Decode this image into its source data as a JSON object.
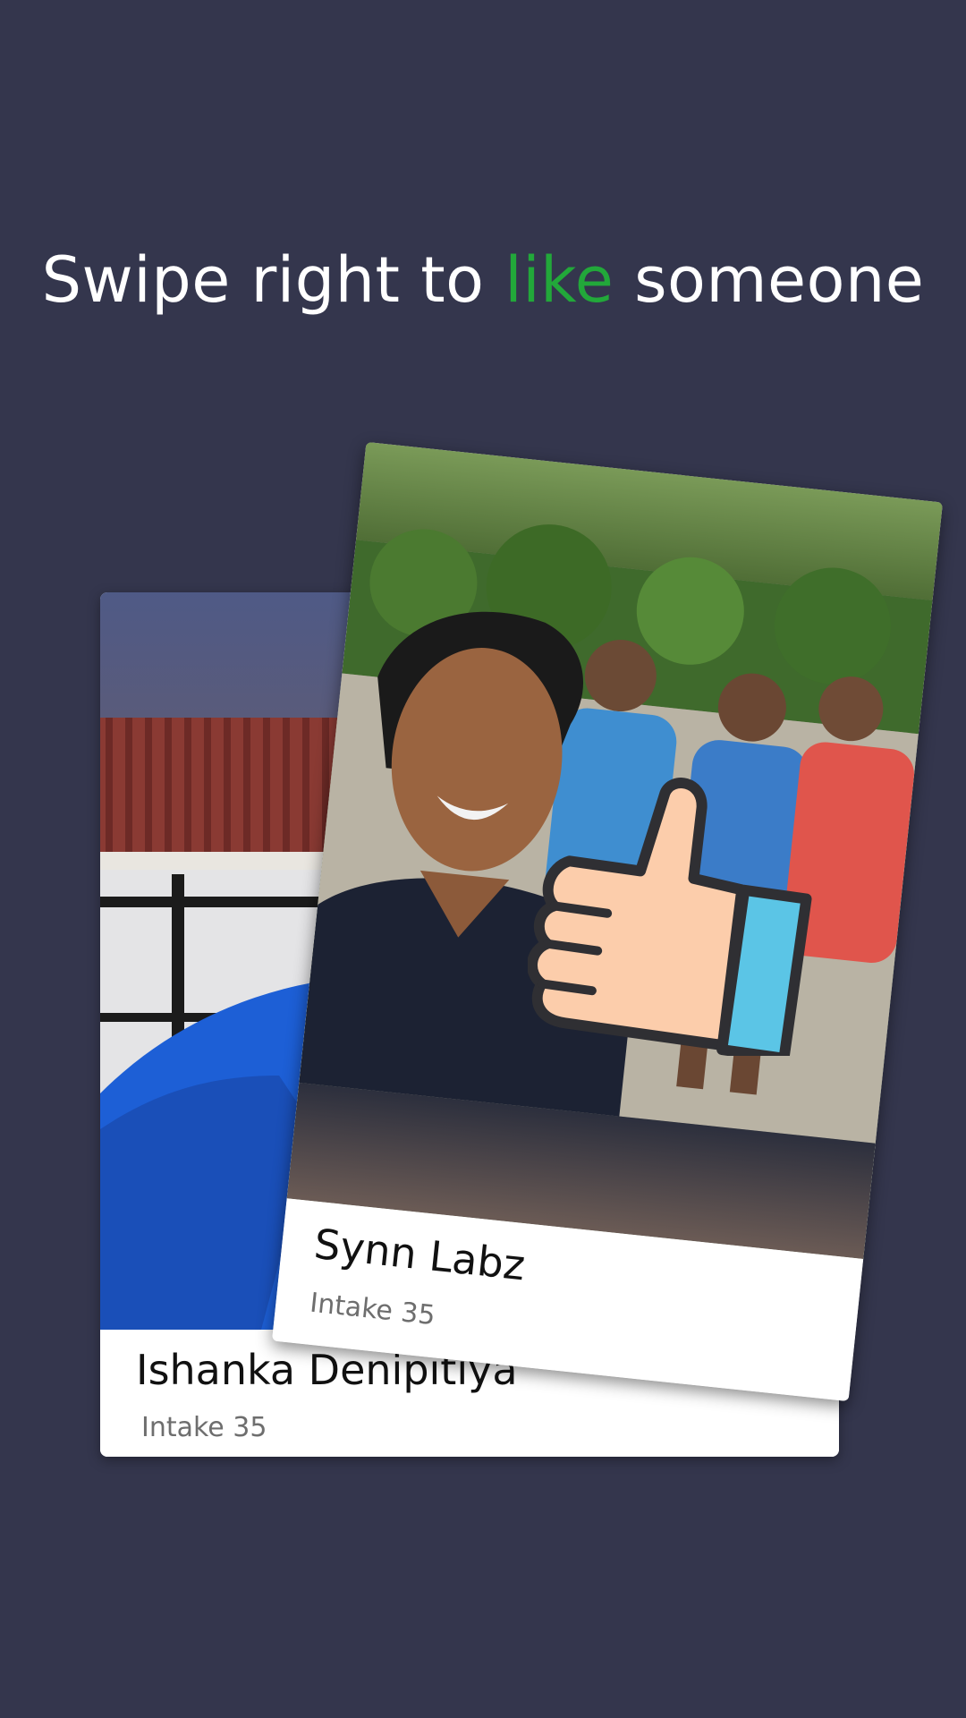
{
  "headline": {
    "prefix": "Swipe right to",
    "accent": "like",
    "suffix": "someone"
  },
  "back_card": {
    "name": "Ishanka Denipitiya",
    "subtitle": "Intake 35"
  },
  "front_card": {
    "name": "Synn Labz",
    "subtitle": "Intake 35"
  },
  "colors": {
    "background": "#34364d",
    "accent": "#22a83a",
    "thumb_skin": "#fccdab",
    "thumb_cuff": "#5bc5e6"
  },
  "icons": {
    "like": "thumbs-up-icon"
  }
}
